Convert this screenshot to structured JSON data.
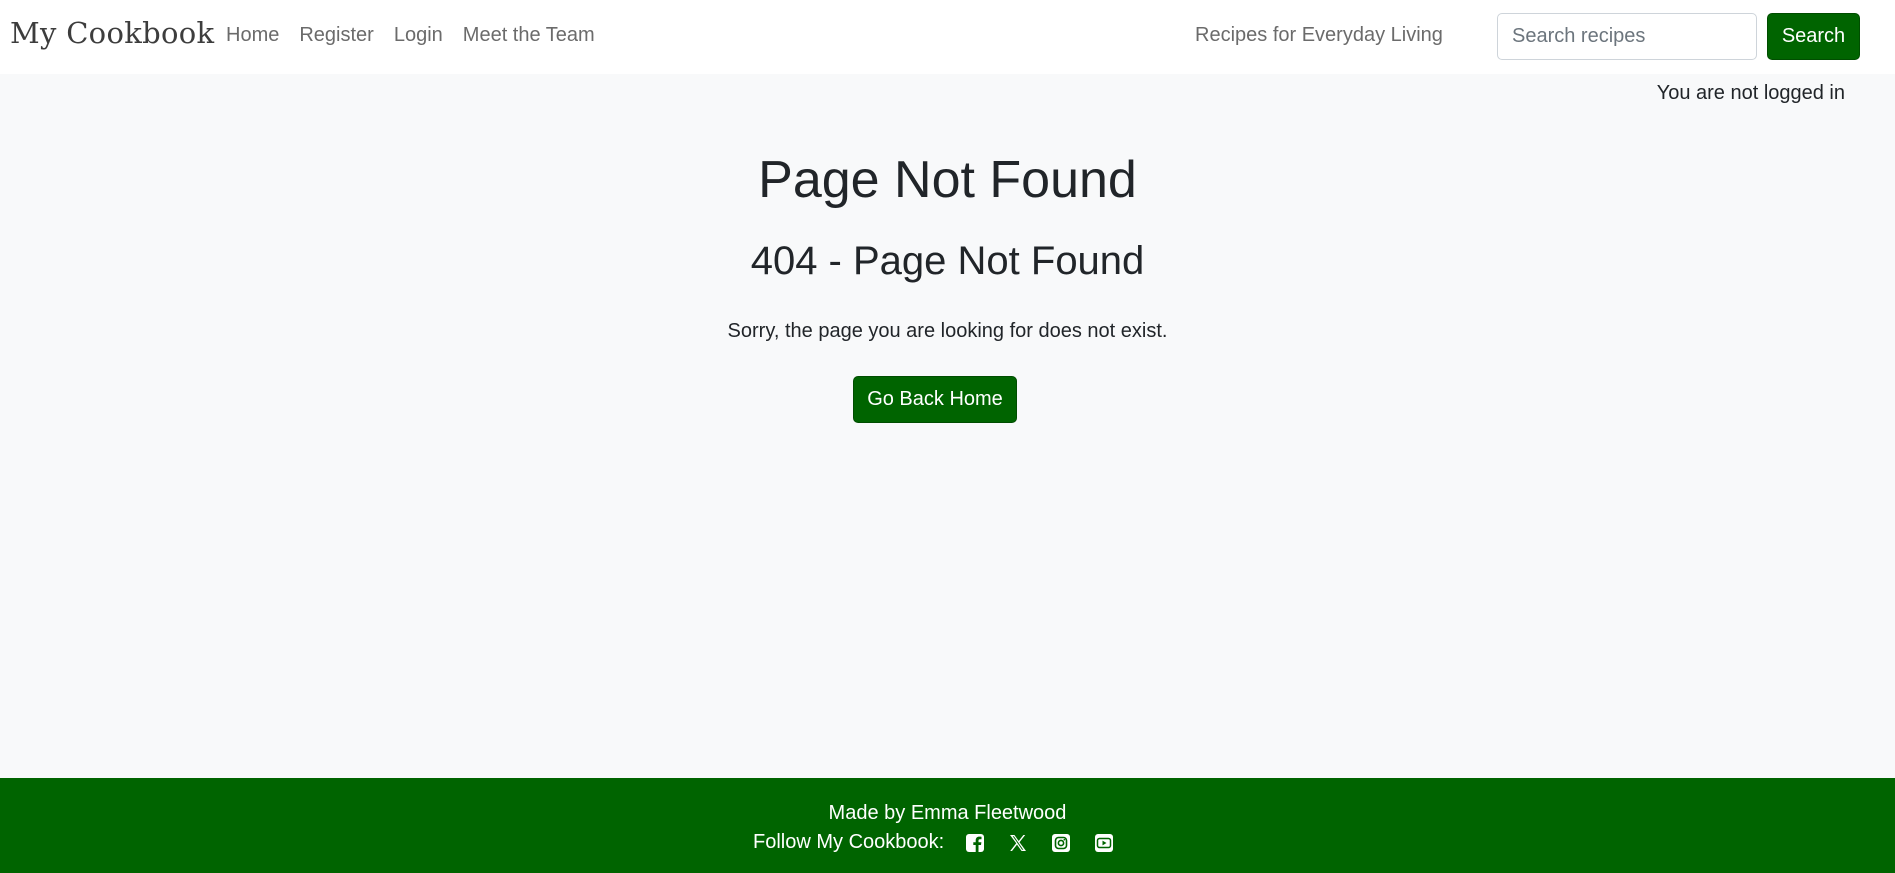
{
  "navbar": {
    "brand": "My Cookbook",
    "links": [
      "Home",
      "Register",
      "Login",
      "Meet the Team"
    ],
    "tagline": "Recipes for Everyday Living",
    "search": {
      "placeholder": "Search recipes",
      "button_label": "Search"
    }
  },
  "login_status": "You are not logged in",
  "main": {
    "title": "Page Not Found",
    "subtitle": "404 - Page Not Found",
    "message": "Sorry, the page you are looking for does not exist.",
    "home_button": "Go Back Home"
  },
  "footer": {
    "credit": "Made by Emma Fleetwood",
    "follow_label": "Follow My Cookbook:",
    "social_icons": [
      "facebook-icon",
      "x-twitter-icon",
      "instagram-icon",
      "youtube-icon"
    ]
  },
  "colors": {
    "brand_green": "#006400",
    "background": "#f8f9fa",
    "nav_text": "#6b6b6b"
  }
}
